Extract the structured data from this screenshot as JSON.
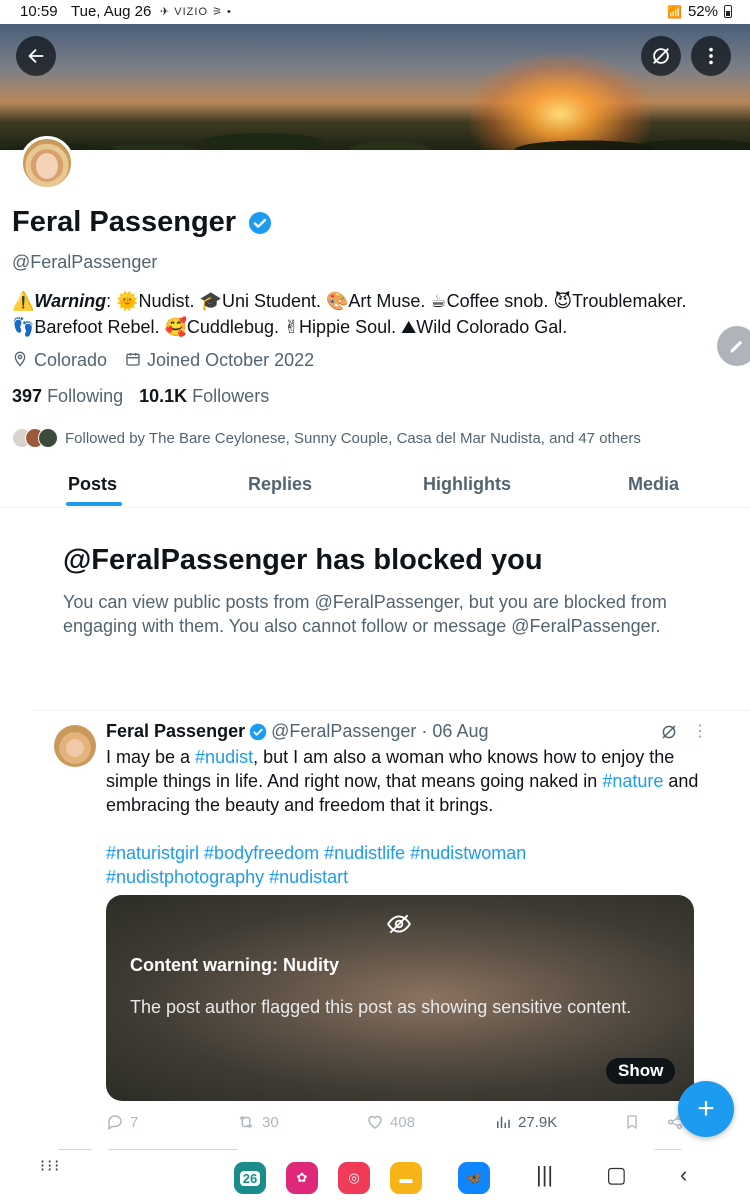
{
  "status_bar": {
    "time": "10:59",
    "date": "Tue, Aug 26",
    "icons_text": "✈ VIZIO ⚞ •",
    "battery": "52%"
  },
  "profile": {
    "display_name": "Feral Passenger",
    "handle": "@FeralPassenger",
    "bio_warning_label": "Warning",
    "bio_line1_rest": ": 🌞Nudist. 🎓Uni Student. 🎨Art Muse. ☕Coffee snob. 😈Troublemaker.",
    "bio_line2": "👣Barefoot Rebel. 🥰Cuddlebug. ✌Hippie Soul. ⛰Wild Colorado Gal.",
    "location": "Colorado",
    "joined": "Joined October 2022",
    "following_count": "397",
    "following_label": "Following",
    "followers_count": "10.1K",
    "followers_label": "Followers",
    "followed_by": "Followed by The Bare Ceylonese, Sunny Couple, Casa del Mar Nudista, and 47 others"
  },
  "tabs": [
    {
      "label": "Posts",
      "active": true
    },
    {
      "label": "Replies",
      "active": false
    },
    {
      "label": "Highlights",
      "active": false
    },
    {
      "label": "Media",
      "active": false
    }
  ],
  "blocked": {
    "title": "@FeralPassenger has blocked you",
    "description": "You can view public posts from @FeralPassenger, but you are blocked from engaging with them. You also cannot follow or message @FeralPassenger."
  },
  "tweet": {
    "author_name": "Feral Passenger",
    "author_handle_date": "@FeralPassenger · 06 Aug",
    "text_1": "I may be a ",
    "hashtag_1": "#nudist",
    "text_2": ", but I am also a woman who knows how to enjoy the  simple things in life. And right now, that means going naked in ",
    "hashtag_2": "#nature",
    "text_3": " and embracing the beauty and freedom that it brings.",
    "hashtags_line1": "#naturistgirl #bodyfreedom #nudistlife #nudistwoman",
    "hashtags_line2": "#nudistphotography #nudistart",
    "content_warning_title": "Content warning: Nudity",
    "content_warning_desc": "The post author flagged this post as showing sensitive content.",
    "show_label": "Show",
    "replies": "7",
    "reposts": "30",
    "likes": "408",
    "views": "27.9K"
  },
  "navbar": {
    "calendar_day": "26"
  },
  "colors": {
    "accent": "#1d9bf0",
    "text": "#0f1419",
    "secondary": "#536471"
  }
}
